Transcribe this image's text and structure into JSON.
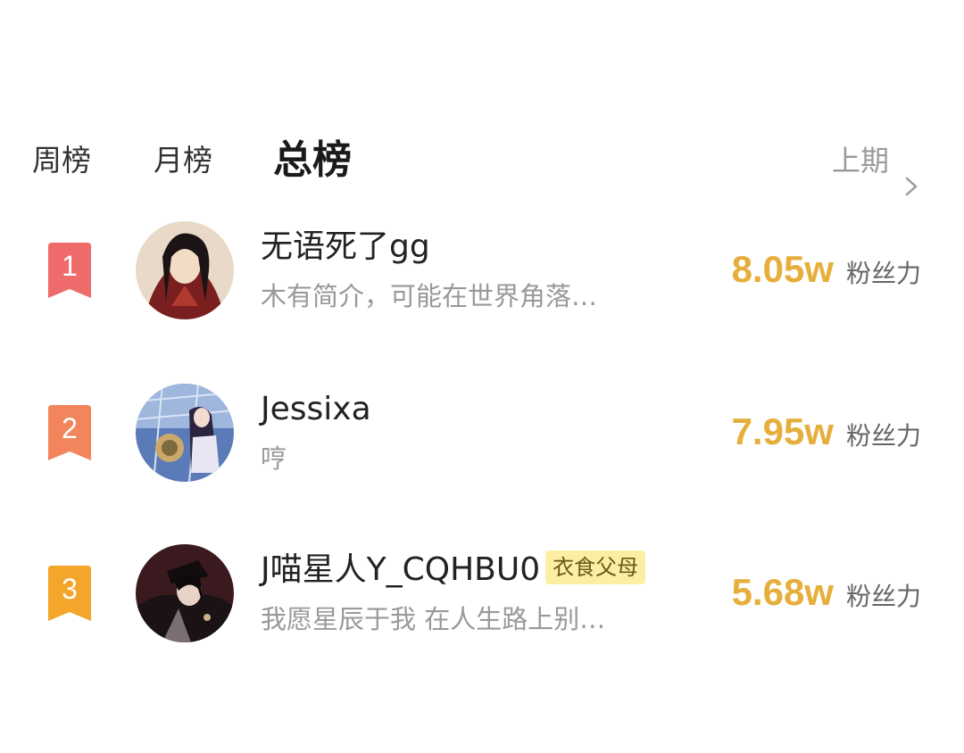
{
  "tabs": {
    "week": "周榜",
    "month": "月榜",
    "all": "总榜",
    "active": "all"
  },
  "prev_period": {
    "label": "上期",
    "icon": "chevron-right-icon"
  },
  "colors": {
    "accent_score": "#e6ae3b",
    "rank1": "#ef6b6b",
    "rank2": "#f2855c",
    "rank3": "#f4a62a",
    "tag_bg": "#fcefa4"
  },
  "ranking": [
    {
      "rank": "1",
      "name": "无语死了gg",
      "tag": "",
      "bio": "木有简介，可能在世界角落…",
      "score": "8.05w",
      "score_label": "粉丝力"
    },
    {
      "rank": "2",
      "name": "Jessixa",
      "tag": "",
      "bio": "哼",
      "score": "7.95w",
      "score_label": "粉丝力"
    },
    {
      "rank": "3",
      "name": "J喵星人Y_CQHBU0",
      "tag": "衣食父母",
      "bio": "我愿星辰于我 在人生路上别…",
      "score": "5.68w",
      "score_label": "粉丝力"
    }
  ]
}
